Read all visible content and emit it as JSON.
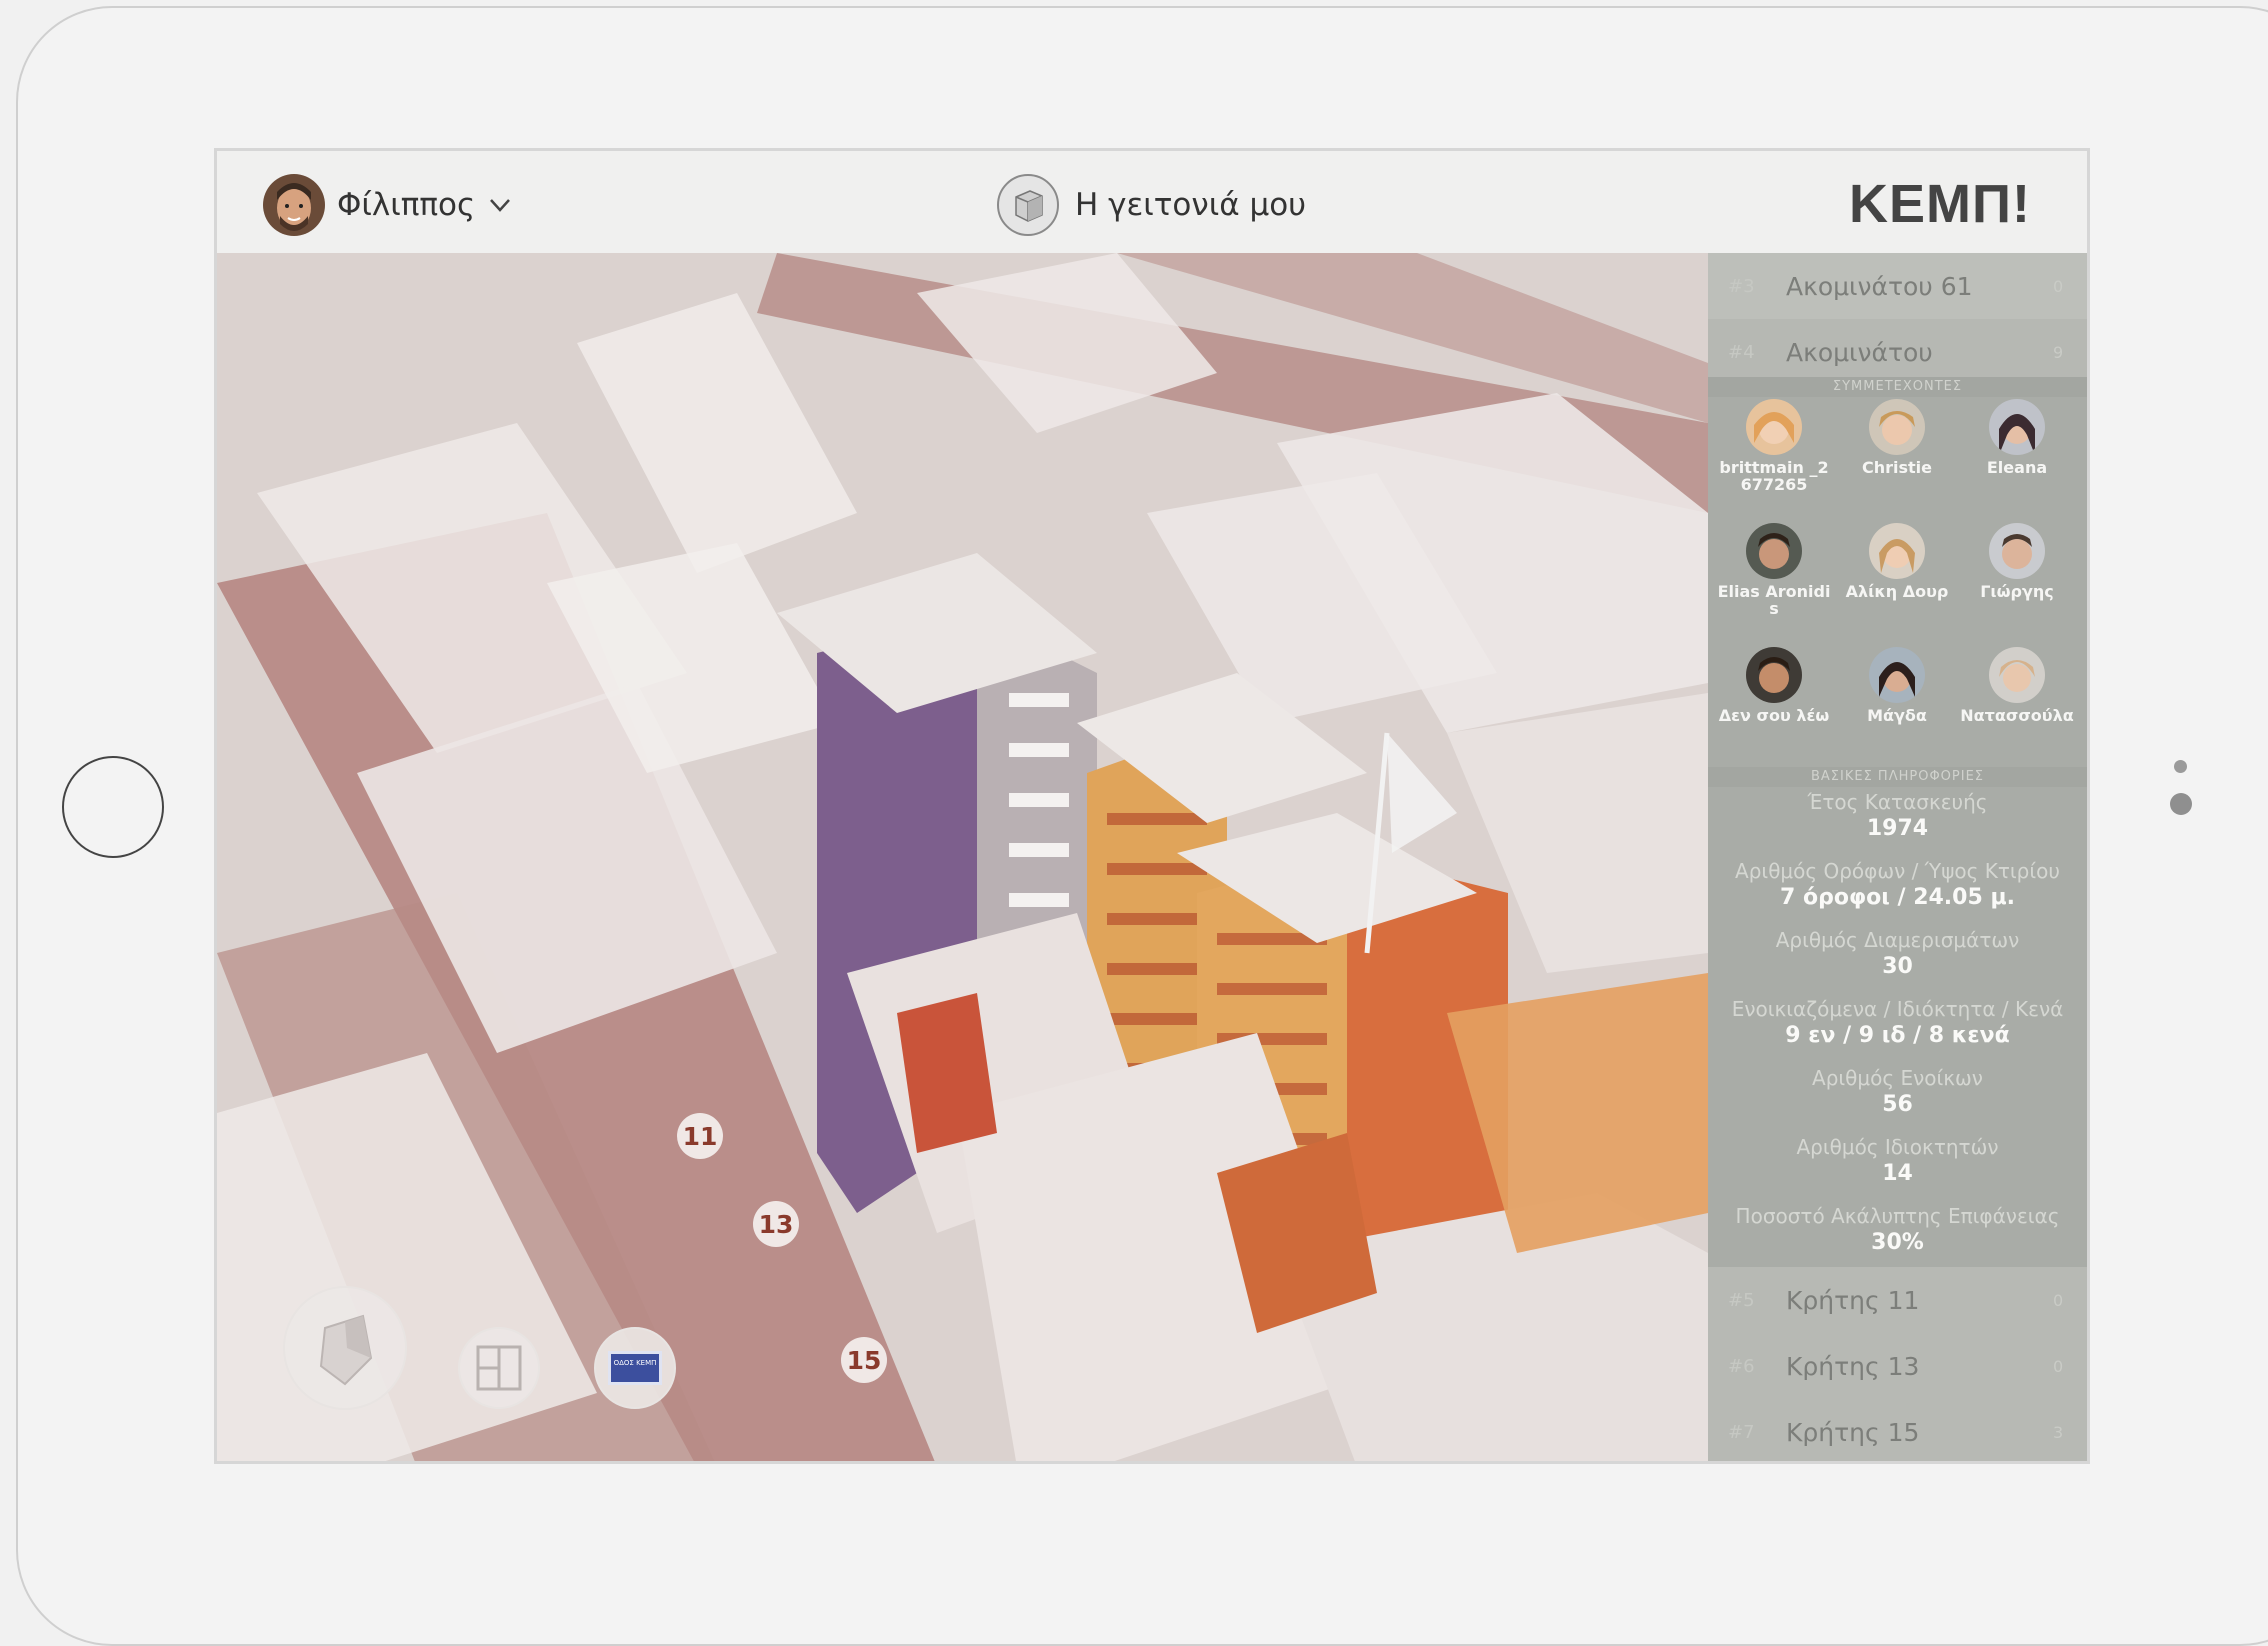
{
  "header": {
    "user_name": "Φίλιππος",
    "neighborhood_label": "Η γειτονιά μου",
    "brand": "ΚΕΜΠ!"
  },
  "map": {
    "markers": [
      "11",
      "13",
      "15"
    ],
    "sign_text": "ΟΔΟΣ ΚΕΜΠ"
  },
  "sidebar": {
    "rows_top": [
      {
        "index": "#3",
        "address": "Ακομινάτου 61",
        "count": "0"
      },
      {
        "index": "#4",
        "address": "Ακομινάτου",
        "count": "9"
      }
    ],
    "participants_title": "ΣΥΜΜΕΤΕΧΟΝΤΕΣ",
    "participants": [
      {
        "name": "brittmain _2677265"
      },
      {
        "name": "Christie"
      },
      {
        "name": "Eleana"
      },
      {
        "name": "Elias Aronidis"
      },
      {
        "name": "Αλίκη Δουρ"
      },
      {
        "name": "Γιώργης"
      },
      {
        "name": "Δεν σου λέω"
      },
      {
        "name": "Μάγδα"
      },
      {
        "name": "Νατασσούλα"
      }
    ],
    "info_title": "ΒΑΣΙΚΕΣ ΠΛΗΡΟΦΟΡΙΕΣ",
    "info": [
      {
        "label": "Έτος Κατασκευής",
        "value": "1974"
      },
      {
        "label": "Αριθμός Ορόφων / Ύψος Κτιρίου",
        "value": "7 όροφοι / 24.05 μ."
      },
      {
        "label": "Αριθμός Διαμερισμάτων",
        "value": "30"
      },
      {
        "label": "Ενοικιαζόμενα / Ιδιόκτητα / Κενά",
        "value": "9 εν / 9 ιδ / 8 κενά"
      },
      {
        "label": "Αριθμός Ενοίκων",
        "value": "56"
      },
      {
        "label": "Αριθμός Ιδιοκτητών",
        "value": "14"
      },
      {
        "label": "Ποσοστό Ακάλυπτης Επιφάνειας",
        "value": "30%"
      }
    ],
    "rows_bottom": [
      {
        "index": "#5",
        "address": "Κρήτης 11",
        "count": "0"
      },
      {
        "index": "#6",
        "address": "Κρήτης 13",
        "count": "0"
      },
      {
        "index": "#7",
        "address": "Κρήτης 15",
        "count": "3"
      }
    ]
  },
  "icons": {
    "user_chevron": "chevron-down-icon",
    "neighborhood": "cube-icon",
    "compass": "compass-icon",
    "floorplan": "floorplan-icon",
    "street_sign": "street-sign-icon"
  },
  "colors": {
    "facade_orange": "#e0a45a",
    "facade_purple": "#7d5f8d",
    "sidebar_bg": "#a9aca7"
  }
}
